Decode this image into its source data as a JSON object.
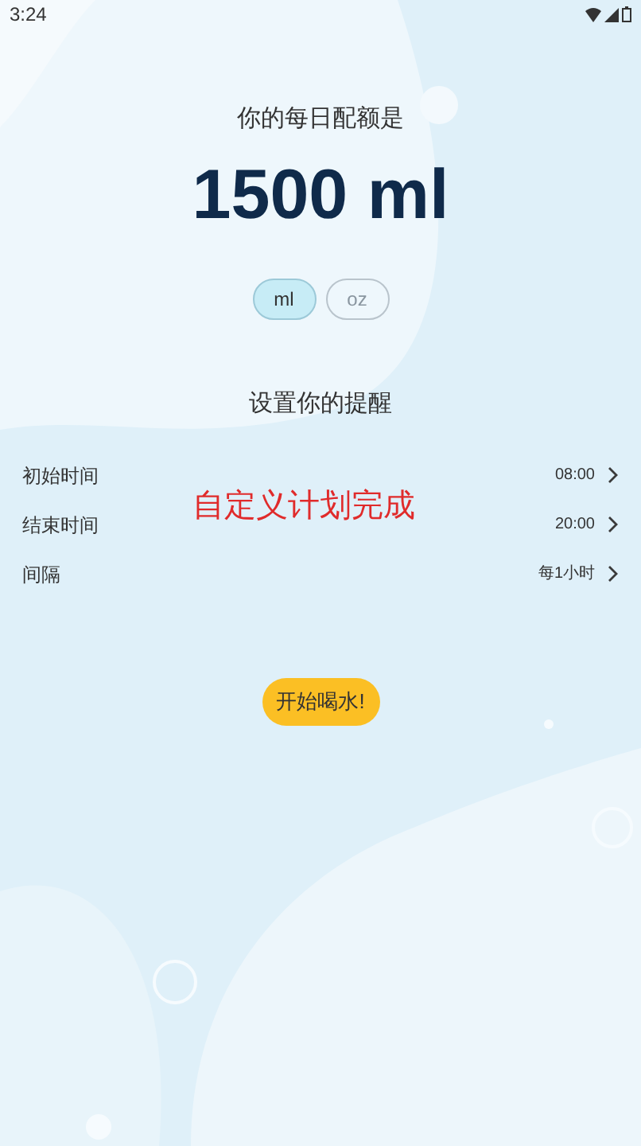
{
  "status_bar": {
    "time": "3:24"
  },
  "quota": {
    "label": "你的每日配额是",
    "amount": "1500 ml"
  },
  "units": [
    {
      "label": "ml",
      "selected": true
    },
    {
      "label": "oz",
      "selected": false
    }
  ],
  "reminders": {
    "title": "设置你的提醒",
    "rows": [
      {
        "label": "初始时间",
        "value": "08:00"
      },
      {
        "label": "结束时间",
        "value": "20:00"
      },
      {
        "label": "间隔",
        "value": "每1小时"
      }
    ]
  },
  "overlay_caption": "自定义计划完成",
  "start_button": "开始喝水!"
}
